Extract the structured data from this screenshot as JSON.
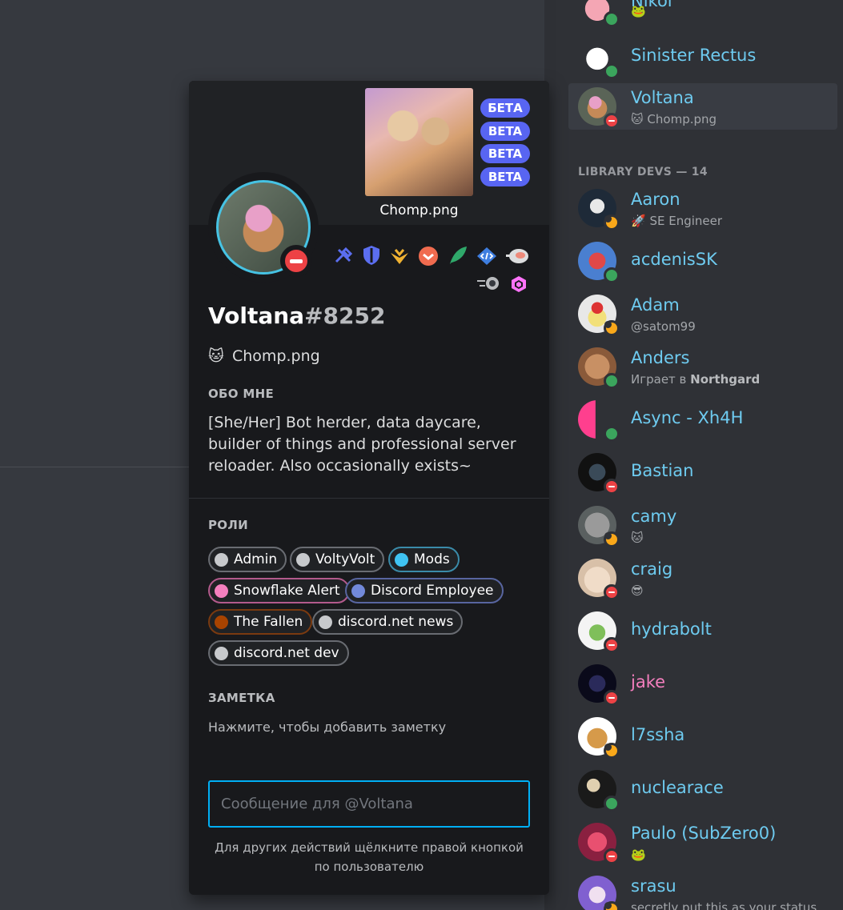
{
  "popout": {
    "activity": {
      "caption": "Chomp.png"
    },
    "beta_badges": [
      "БЕТА",
      "BETA",
      "BETA",
      "BETA"
    ],
    "username": "Voltana",
    "discriminator": "#8252",
    "custom_status": {
      "emoji": "🐱",
      "text": "Chomp.png"
    },
    "about_title": "ОБО МНЕ",
    "about_text": "[She/Her] Bot herder, data daycare, builder of things and professional server reloader. Also occasionally exists~",
    "roles_title": "РОЛИ",
    "roles": [
      {
        "name": "Admin",
        "color": "#c7c9cc"
      },
      {
        "name": "VoltyVolt",
        "color": "#c7c9cc"
      },
      {
        "name": "Mods",
        "color": "#3fc3f2"
      },
      {
        "name": "Snowflake Alert",
        "color": "#f47fbe"
      },
      {
        "name": "Discord Employee",
        "color": "#7289da"
      },
      {
        "name": "The Fallen",
        "color": "#a84300"
      },
      {
        "name": "discord.net news",
        "color": "#c7c9cc"
      },
      {
        "name": "discord.net dev",
        "color": "#c7c9cc"
      }
    ],
    "note_title": "ЗАМЕТКА",
    "note_placeholder": "Нажмите, чтобы добавить заметку",
    "message_placeholder": "Сообщение для @Voltana",
    "footer_hint": "Для других действий щёлкните правой кнопкой по пользователю"
  },
  "members": {
    "section_header": "LIBRARY DEVS — 14",
    "top": [
      {
        "name": "Nikol",
        "status": "online",
        "sub_emoji": "🐸"
      },
      {
        "name": "Sinister Rectus",
        "status": "online"
      },
      {
        "name": "Voltana",
        "status": "dnd",
        "sub_emoji": "🐱",
        "sub": "Chomp.png",
        "selected": true
      }
    ],
    "list": [
      {
        "name": "Aaron",
        "status": "idle",
        "sub_emoji": "🚀",
        "sub": "SE Engineer"
      },
      {
        "name": "acdenisSK",
        "status": "online"
      },
      {
        "name": "Adam",
        "status": "idle",
        "sub": "@satom99"
      },
      {
        "name": "Anders",
        "status": "online",
        "sub": "Играет в",
        "sub_bold": "Northgard"
      },
      {
        "name": "Async - Xh4H",
        "status": "online"
      },
      {
        "name": "Bastian",
        "status": "dnd"
      },
      {
        "name": "camy",
        "status": "idle",
        "sub_emoji": "🐱"
      },
      {
        "name": "craig",
        "status": "dnd",
        "sub_emoji": "😎"
      },
      {
        "name": "hydrabolt",
        "status": "dnd"
      },
      {
        "name": "jake",
        "status": "dnd",
        "pink": true
      },
      {
        "name": "l7ssha",
        "status": "idle"
      },
      {
        "name": "nuclearace",
        "status": "online"
      },
      {
        "name": "Paulo (SubZero0)",
        "status": "dnd",
        "sub_emoji": "🐸"
      },
      {
        "name": "srasu",
        "status": "idle",
        "sub": "secretly put this as your status"
      }
    ]
  },
  "colors": {
    "accent": "#5865f2",
    "focus": "#00aff4",
    "online": "#3ba55d",
    "idle": "#faa81a",
    "dnd": "#ed4245"
  }
}
